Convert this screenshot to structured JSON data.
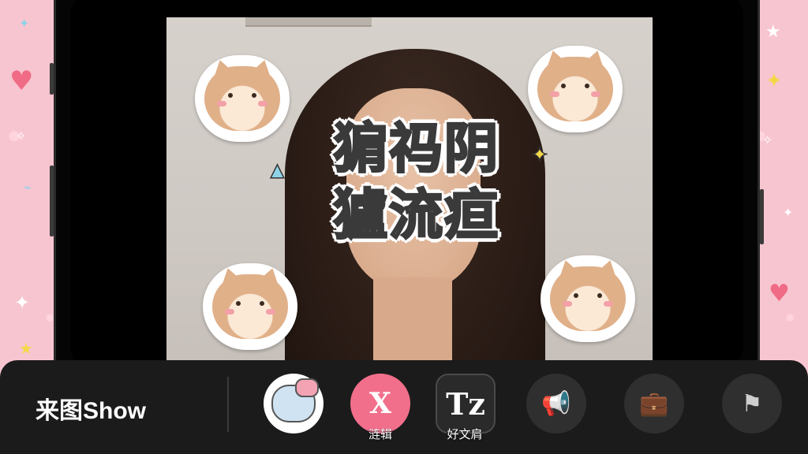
{
  "sticker_title": {
    "line1": "猏祃阴",
    "line2": "獹流疸"
  },
  "toolbar": {
    "brand": "来图Show",
    "tools": [
      {
        "icon": "cat-sticker-icon",
        "label": ""
      },
      {
        "icon": "edit-x-icon",
        "glyph": "X",
        "label": "涟辑"
      },
      {
        "icon": "text-tool-icon",
        "glyph": "Tz",
        "label": "好文肩"
      },
      {
        "icon": "megaphone-icon",
        "glyph": "📢",
        "label": ""
      },
      {
        "icon": "briefcase-icon",
        "glyph": "💼",
        "label": ""
      },
      {
        "icon": "flag-circle-icon",
        "glyph": "⚑",
        "label": ""
      }
    ]
  },
  "colors": {
    "title_pink": "#f29aa7",
    "title_teal": "#7fd1c6",
    "toolbar_bg": "#1b1b1b",
    "edit_accent": "#f26f8c",
    "side_pink": "#f7c5d0"
  }
}
